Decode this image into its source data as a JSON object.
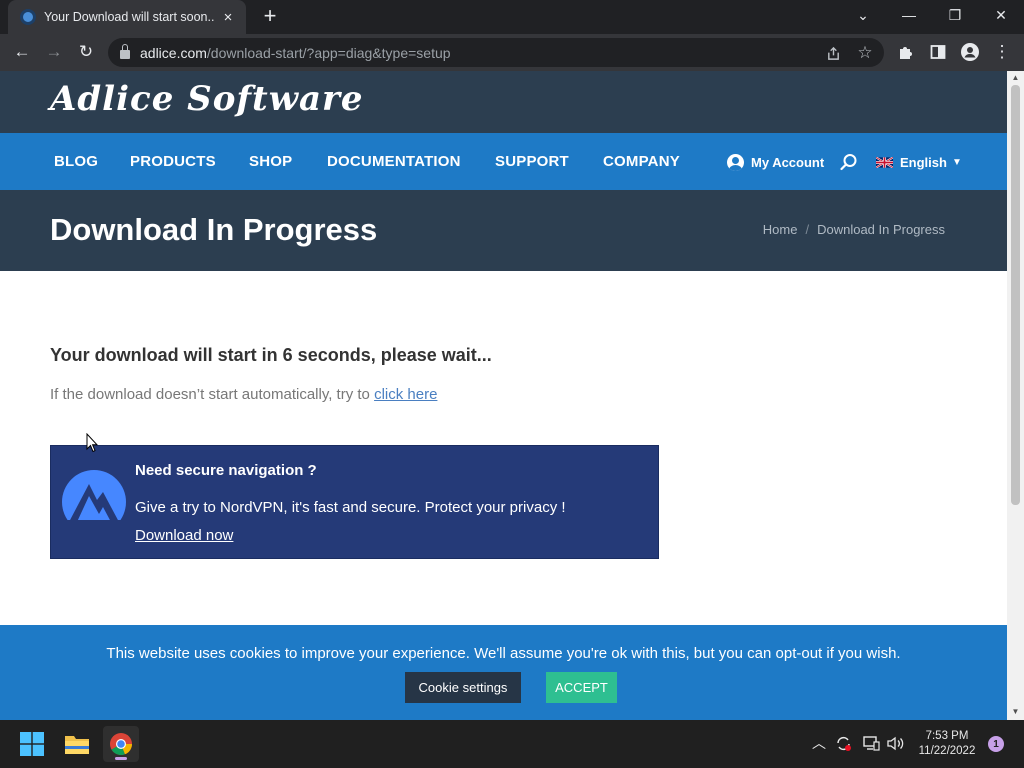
{
  "browser": {
    "tab": {
      "title": "Your Download will start soon... -",
      "close_icon": "×"
    },
    "new_tab_icon": "+",
    "window_controls": {
      "dropdown": "⌄",
      "minimize": "—",
      "restore": "❐",
      "close": "✕"
    },
    "toolbar": {
      "back": "←",
      "forward": "→",
      "reload": "↻",
      "extensions": "puzzle-icon",
      "sidepanel": "sidepanel-icon",
      "profile": "profile-icon",
      "menu": "⋮"
    },
    "url": {
      "host": "adlice.com",
      "path": "/download-start/?app=diag&type=setup"
    }
  },
  "site": {
    "logo": "Adlice Software",
    "nav": [
      "BLOG",
      "PRODUCTS",
      "SHOP",
      "DOCUMENTATION",
      "SUPPORT",
      "COMPANY"
    ],
    "account_label": "My Account",
    "language": "English",
    "colors": {
      "header": "#2c3e50",
      "nav": "#1e7ac6",
      "vpn": "#253a78",
      "accept": "#2ebf91"
    }
  },
  "title_band": {
    "title": "Download In Progress",
    "breadcrumb": {
      "home": "Home",
      "separator": "/",
      "current": "Download In Progress"
    }
  },
  "content": {
    "wait_message": "Your download will start in 6 seconds, please wait...",
    "hint_prefix": "If the download doesn’t start automatically, try to ",
    "hint_link": "click here"
  },
  "vpn_promo": {
    "heading": "Need secure navigation ?",
    "text": "Give a try to NordVPN, it's fast and secure. Protect your privacy !",
    "link": "Download now"
  },
  "cookie_bar": {
    "text": "This website uses cookies to improve your experience. We'll assume you're ok with this, but you can opt-out if you wish.",
    "settings_label": "Cookie settings",
    "accept_label": "ACCEPT"
  },
  "taskbar": {
    "time": "7:53 PM",
    "date": "11/22/2022",
    "notification_count": "1"
  }
}
